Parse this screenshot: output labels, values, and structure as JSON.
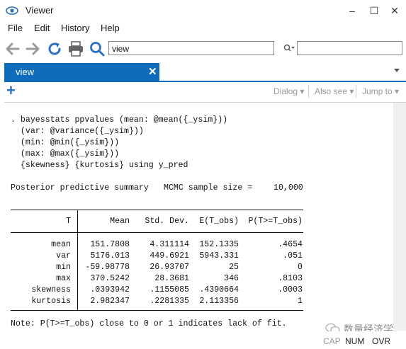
{
  "window": {
    "title": "Viewer",
    "minimize": "–",
    "maximize": "☐",
    "close": "✕"
  },
  "menu": [
    "File",
    "Edit",
    "History",
    "Help"
  ],
  "toolbar": {
    "search_value": "view"
  },
  "tab": {
    "label": "view",
    "close": "✕"
  },
  "viewbar": {
    "add": "+",
    "dialog": "Dialog",
    "also_see": "Also see",
    "jump_to": "Jump to"
  },
  "command": [
    ". bayesstats ppvalues (mean: @mean({_ysim}))",
    "  (var: @variance({_ysim}))",
    "  (min: @min({_ysim}))",
    "  (max: @max({_ysim}))",
    "  {skewness} {kurtosis} using y_pred"
  ],
  "summary": {
    "left": "Posterior predictive summary",
    "right": "MCMC sample size =",
    "size": "10,000"
  },
  "table": {
    "headers": [
      "T",
      "Mean",
      "Std. Dev.",
      "E(T_obs)",
      "P(T>=T_obs)"
    ],
    "rows": [
      [
        "mean",
        "151.7808",
        "4.311114",
        "152.1335",
        ".4654"
      ],
      [
        "var",
        "5176.013",
        "449.6921",
        "5943.331",
        ".051"
      ],
      [
        "min",
        "-59.98778",
        "26.93707",
        "25",
        "0"
      ],
      [
        "max",
        "370.5242",
        "28.3681",
        "346",
        ".8103"
      ],
      [
        "skewness",
        ".0393942",
        ".1155085",
        ".4390664",
        ".0003"
      ],
      [
        "kurtosis",
        "2.982347",
        ".2281335",
        "2.113356",
        "1"
      ]
    ]
  },
  "note": "Note: P(T>=T_obs) close to 0 or 1 indicates lack of fit.",
  "watermark": "数量经济学",
  "status": {
    "cap": "CAP",
    "num": "NUM",
    "ovr": "OVR"
  },
  "colors": {
    "accent": "#0f6cbd",
    "toolbar_icon": "#2a72c8",
    "disabled": "#9a9a9a"
  }
}
